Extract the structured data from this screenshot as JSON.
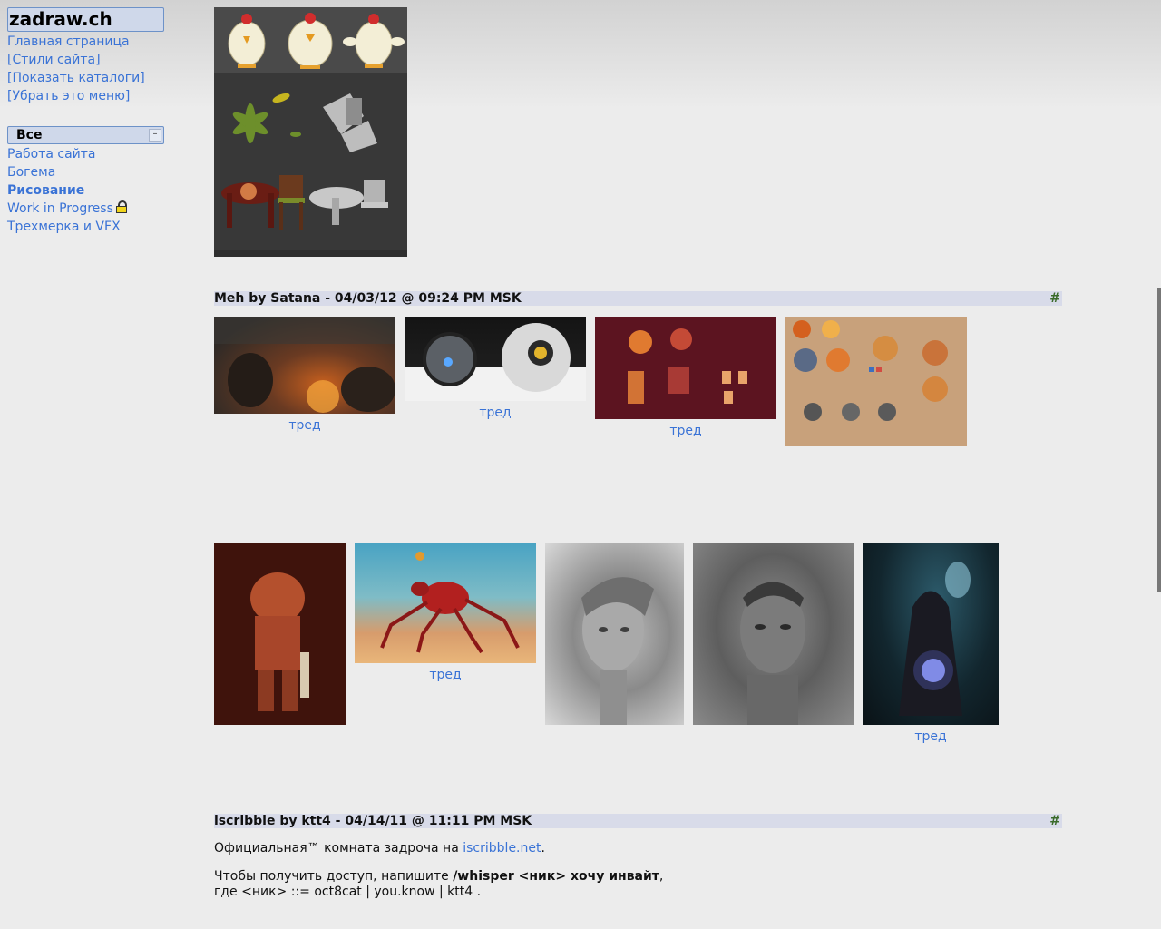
{
  "site": {
    "title": "zadraw.ch"
  },
  "menu": {
    "links": [
      "Главная страница",
      "[Стили сайта]",
      "[Показать каталоги]",
      "[Убрать это меню]"
    ]
  },
  "section": {
    "label": "Все",
    "collapse_symbol": "–"
  },
  "categories": [
    {
      "label": "Работа сайта",
      "active": false
    },
    {
      "label": "Богема",
      "active": false
    },
    {
      "label": "Рисование",
      "active": true
    },
    {
      "label": "Work in Progress",
      "active": false,
      "icon": "lock-icon"
    },
    {
      "label": "Трехмерка и VFX",
      "active": false
    }
  ],
  "thread_link": "тред",
  "posts": [
    {
      "title": "Meh by Satana - 04/03/12 @ 09:24 PM MSK",
      "anchor": "#"
    },
    {
      "title": "iscribble by ktt4 - 04/14/11 @ 11:11 PM MSK",
      "anchor": "#",
      "line1_prefix": "Официальная™ комната задроча на ",
      "line1_link": "iscribble.net",
      "line1_suffix": ".",
      "line2_prefix": "Чтобы получить доступ, напишите ",
      "line2_command": "/whisper <ник> хочу инвайт",
      "line2_suffix": ",",
      "line3": "где <ник> ::= oct8cat | you.know | ktt4 ."
    }
  ],
  "colors": {
    "link": "#3a73d6",
    "header_bg": "#cfd8ea",
    "header_border": "#6d92c8",
    "post_head_bg": "#d8dbe9",
    "lock": "#f1d51c"
  }
}
